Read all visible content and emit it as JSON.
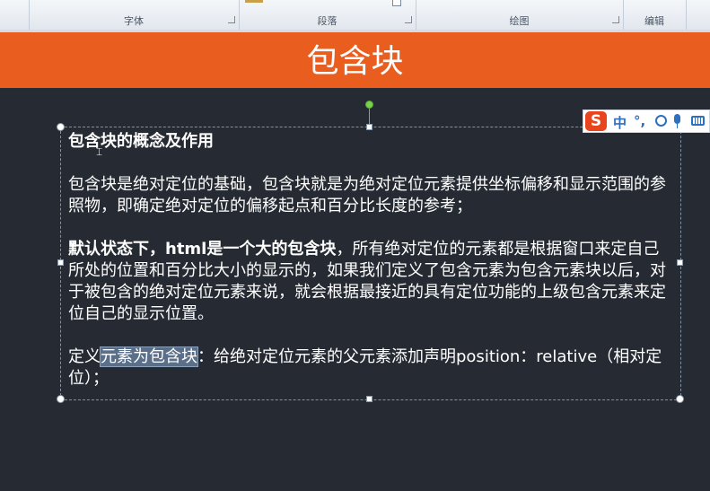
{
  "ribbon": {
    "groups": [
      {
        "label": "字体"
      },
      {
        "label": "段落"
      },
      {
        "label": "绘图"
      },
      {
        "label": "编辑"
      }
    ]
  },
  "slide": {
    "title": "包含块",
    "heading": "包含块的概念及作用",
    "para1": "包含块是绝对定位的基础，包含块就是为绝对定位元素提供坐标偏移和显示范围的参照物，即确定绝对定位的偏移起点和百分比长度的参考；",
    "para2_bold": "默认状态下，html是一个大的包含块",
    "para2_rest": "，所有绝对定位的元素都是根据窗口来定自己所处的位置和百分比大小的显示的，如果我们定义了包含元素为包含元素块以后，对于被包含的绝对定位元素来说，就会根据最接近的具有定位功能的上级包含元素来定位自己的显示位置。",
    "para3_pre": "定义",
    "para3_highlight": "元素为包含块",
    "para3_post": "：给绝对定位元素的父元素添加声明position：relative（相对定位）；"
  },
  "ime": {
    "logo": "S",
    "lang": "中",
    "punct": "°,",
    "icons": [
      "smiley-icon",
      "microphone-icon",
      "keyboard-icon"
    ]
  },
  "colors": {
    "title_bar": "#e95e1e",
    "slide_bg": "#262b33",
    "text": "#ffffff",
    "selection": "#5b6f88"
  }
}
